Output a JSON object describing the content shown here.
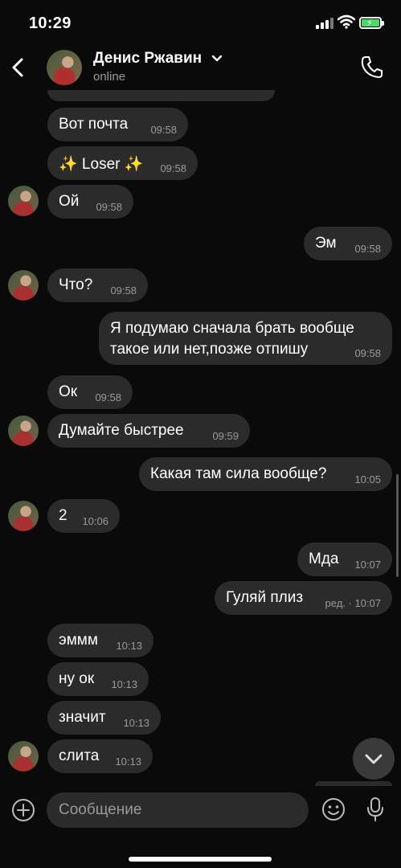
{
  "status_bar": {
    "time": "10:29"
  },
  "header": {
    "contact_name": "Денис Ржавин",
    "presence": "online"
  },
  "messages": [
    {
      "text": "Вот почта",
      "time": "09:58"
    },
    {
      "text": "✨ Loser ✨",
      "time": "09:58"
    },
    {
      "text": "Ой",
      "time": "09:58"
    },
    {
      "text": "Эм",
      "time": "09:58"
    },
    {
      "text": "Что?",
      "time": "09:58"
    },
    {
      "text": "Я подумаю сначала брать вообще\nтакое или нет,позже отпишу",
      "time": "09:58"
    },
    {
      "text": "Ок",
      "time": "09:58"
    },
    {
      "text": "Думайте быстрее",
      "time": "09:59"
    },
    {
      "text": "Какая там сила вообще?",
      "time": "10:05"
    },
    {
      "text": "2",
      "time": "10:06"
    },
    {
      "text": "Мда",
      "time": "10:07"
    },
    {
      "text": "Гуляй плиз",
      "time": "ред. · 10:07"
    },
    {
      "text": "эммм",
      "time": "10:13"
    },
    {
      "text": "ну ок",
      "time": "10:13"
    },
    {
      "text": "значит",
      "time": "10:13"
    },
    {
      "text": "слита",
      "time": "10:13"
    }
  ],
  "composer": {
    "placeholder": "Сообщение"
  }
}
